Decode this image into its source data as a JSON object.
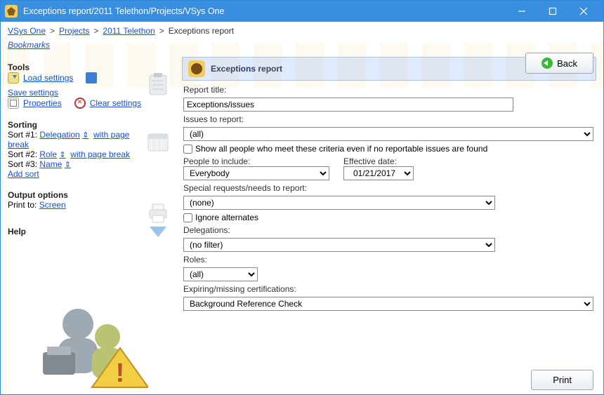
{
  "window": {
    "title": "Exceptions report/2011 Telethon/Projects/VSys One"
  },
  "breadcrumbs": {
    "items": [
      "VSys One",
      "Projects",
      "2011 Telethon"
    ],
    "current": "Exceptions report"
  },
  "back_button": "Back",
  "bookmarks_link": "Bookmarks",
  "sidebar": {
    "tools_header": "Tools",
    "load_settings": "Load settings",
    "save_settings": "Save settings",
    "properties": "Properties",
    "clear_settings": "Clear settings",
    "sorting_header": "Sorting",
    "sort1_prefix": "Sort #1: ",
    "sort1_field": "Delegation",
    "sort1_suffix": "with page break",
    "sort2_prefix": "Sort #2: ",
    "sort2_field": "Role",
    "sort2_suffix": "with page break",
    "sort3_prefix": "Sort #3: ",
    "sort3_field": "Name",
    "add_sort": "Add sort",
    "output_header": "Output options",
    "print_to_label": "Print to: ",
    "print_to_value": "Screen",
    "help_header": "Help"
  },
  "main": {
    "header": "Exceptions report",
    "report_title_label": "Report title:",
    "report_title_value": "Exceptions/issues",
    "issues_label": "Issues to report:",
    "issues_value": "(all)",
    "show_all_label": "Show all people who meet these criteria even if no reportable issues are found",
    "people_label": "People to include:",
    "people_value": "Everybody",
    "eff_date_label": "Effective date:",
    "eff_date_value": "01/21/2017",
    "special_label": "Special requests/needs to report:",
    "special_value": "(none)",
    "ignore_alt_label": "Ignore alternates",
    "delegations_label": "Delegations:",
    "delegations_value": "(no filter)",
    "roles_label": "Roles:",
    "roles_value": "(all)",
    "certs_label": "Expiring/missing certifications:",
    "certs_value": "Background Reference Check"
  },
  "footer": {
    "print_button": "Print"
  }
}
